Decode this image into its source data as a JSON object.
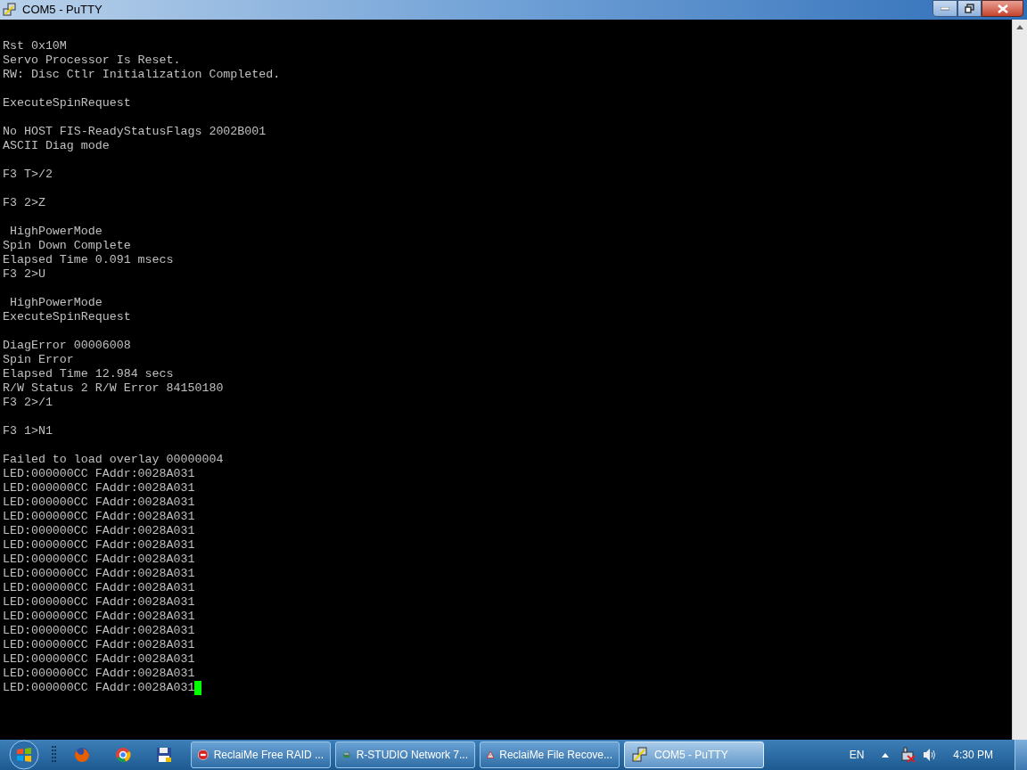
{
  "window": {
    "title": "COM5 - PuTTY"
  },
  "terminal": {
    "blocks": [
      [
        "Rst 0x10M",
        "Servo Processor Is Reset.",
        "RW: Disc Ctlr Initialization Completed."
      ],
      [
        "ExecuteSpinRequest"
      ],
      [
        "No HOST FIS-ReadyStatusFlags 2002B001",
        "ASCII Diag mode"
      ],
      [
        "F3 T>/2"
      ],
      [
        "F3 2>Z"
      ],
      [
        " HighPowerMode",
        "Spin Down Complete",
        "Elapsed Time 0.091 msecs",
        "F3 2>U"
      ],
      [
        " HighPowerMode",
        "ExecuteSpinRequest"
      ],
      [
        "DiagError 00006008",
        "Spin Error",
        "Elapsed Time 12.984 secs",
        "R/W Status 2 R/W Error 84150180",
        "F3 2>/1"
      ],
      [
        "F3 1>N1"
      ],
      [
        "Failed to load overlay 00000004",
        "LED:000000CC FAddr:0028A031",
        "LED:000000CC FAddr:0028A031",
        "LED:000000CC FAddr:0028A031",
        "LED:000000CC FAddr:0028A031",
        "LED:000000CC FAddr:0028A031",
        "LED:000000CC FAddr:0028A031",
        "LED:000000CC FAddr:0028A031",
        "LED:000000CC FAddr:0028A031",
        "LED:000000CC FAddr:0028A031",
        "LED:000000CC FAddr:0028A031",
        "LED:000000CC FAddr:0028A031",
        "LED:000000CC FAddr:0028A031",
        "LED:000000CC FAddr:0028A031",
        "LED:000000CC FAddr:0028A031",
        "LED:000000CC FAddr:0028A031",
        "LED:000000CC FAddr:0028A031"
      ]
    ],
    "cursor": true
  },
  "taskbar": {
    "pinned": [
      {
        "kind": "firefox"
      },
      {
        "kind": "chrome"
      },
      {
        "kind": "floppy"
      }
    ],
    "tasks": [
      {
        "label": "ReclaiMe Free RAID ...",
        "kind": "stop",
        "selected": false
      },
      {
        "label": "R-STUDIO Network 7...",
        "kind": "disk",
        "selected": false
      },
      {
        "label": "ReclaiMe File Recove...",
        "kind": "warning",
        "selected": false
      },
      {
        "label": "COM5 - PuTTY",
        "kind": "putty",
        "selected": true
      }
    ],
    "language": "EN",
    "clock": "4:30 PM"
  }
}
